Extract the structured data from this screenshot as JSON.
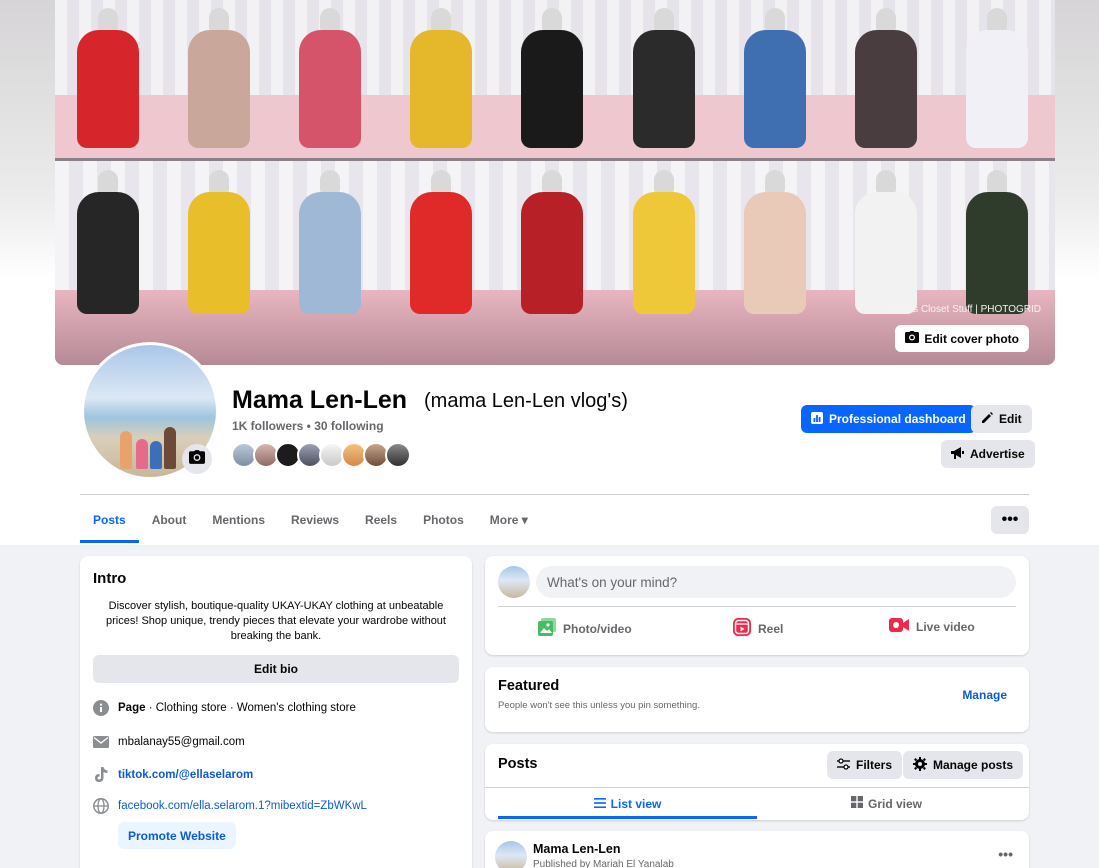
{
  "cover": {
    "credit": "Glenas Closet Stuff | PHOTOGRID",
    "edit_label": "Edit cover photo"
  },
  "profile": {
    "name": "Mama Len-Len",
    "alt_name": "(mama Len-Len vlog's)",
    "followers_line": "1K followers • 30 following"
  },
  "actions": {
    "dashboard_label": "Professional dashboard",
    "edit_label": "Edit",
    "advertise_label": "Advertise",
    "more_label": "•••"
  },
  "tabs": [
    {
      "label": "Posts",
      "active": true
    },
    {
      "label": "About"
    },
    {
      "label": "Mentions"
    },
    {
      "label": "Reviews"
    },
    {
      "label": "Reels"
    },
    {
      "label": "Photos"
    },
    {
      "label": "More ▾"
    }
  ],
  "intro": {
    "title": "Intro",
    "bio": "Discover stylish, boutique-quality UKAY-UKAY clothing at unbeatable prices! Shop unique, trendy pieces that elevate your wardrobe without breaking the bank.",
    "edit_bio": "Edit bio",
    "page_label": "Page",
    "page_categories": " · Clothing store · Women's clothing store",
    "email": "mbalanay55@gmail.com",
    "tiktok": "tiktok.com/@ellaselarom",
    "facebook": "facebook.com/ella.selarom.1?mibextid=ZbWKwL",
    "promote": "Promote Website"
  },
  "composer": {
    "placeholder": "What's on your mind?",
    "photo_video": "Photo/video",
    "reel": "Reel",
    "live_video": "Live video"
  },
  "featured": {
    "title": "Featured",
    "subtitle": "People won't see this unless you pin something.",
    "manage": "Manage"
  },
  "posts": {
    "title": "Posts",
    "filters": "Filters",
    "manage_posts": "Manage posts",
    "list_view": "List view",
    "grid_view": "Grid view"
  },
  "post": {
    "author": "Mama Len-Len",
    "published_by": "Published by Mariah El Yanalab",
    "more": "•••"
  },
  "colors": {
    "accent": "#0866ff",
    "link": "#0b5bd3",
    "page_bg": "#f0f2f5"
  }
}
